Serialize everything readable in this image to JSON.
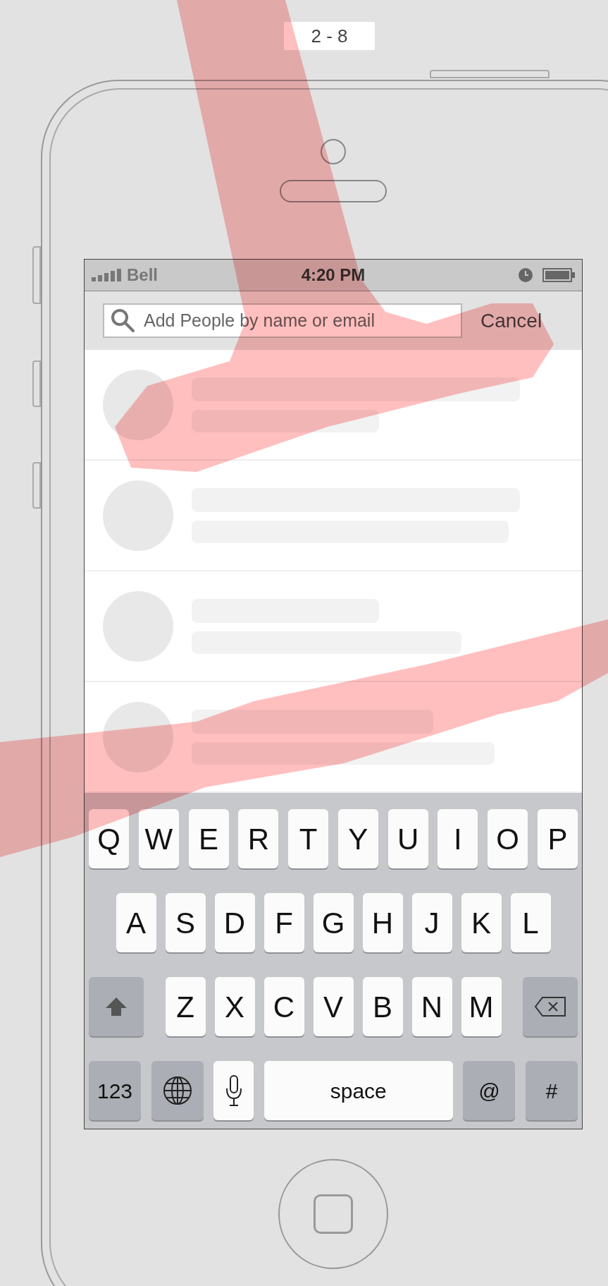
{
  "frame_label": "2 - 8",
  "status_bar": {
    "carrier": "Bell",
    "time": "4:20 PM"
  },
  "search": {
    "placeholder": "Add People by name or email",
    "cancel": "Cancel"
  },
  "keyboard": {
    "rows": [
      {
        "keys": [
          {
            "kind": "letter",
            "label": "Q"
          },
          {
            "kind": "letter",
            "label": "W"
          },
          {
            "kind": "letter",
            "label": "E"
          },
          {
            "kind": "letter",
            "label": "R"
          },
          {
            "kind": "letter",
            "label": "T"
          },
          {
            "kind": "letter",
            "label": "Y"
          },
          {
            "kind": "letter",
            "label": "U"
          },
          {
            "kind": "letter",
            "label": "I"
          },
          {
            "kind": "letter",
            "label": "O"
          },
          {
            "kind": "letter",
            "label": "P"
          }
        ]
      },
      {
        "keys": [
          {
            "kind": "letter",
            "label": "A"
          },
          {
            "kind": "letter",
            "label": "S"
          },
          {
            "kind": "letter",
            "label": "D"
          },
          {
            "kind": "letter",
            "label": "F"
          },
          {
            "kind": "letter",
            "label": "G"
          },
          {
            "kind": "letter",
            "label": "H"
          },
          {
            "kind": "letter",
            "label": "J"
          },
          {
            "kind": "letter",
            "label": "K"
          },
          {
            "kind": "letter",
            "label": "L"
          }
        ]
      },
      {
        "keys": [
          {
            "kind": "shift"
          },
          {
            "kind": "letter",
            "label": "Z"
          },
          {
            "kind": "letter",
            "label": "X"
          },
          {
            "kind": "letter",
            "label": "C"
          },
          {
            "kind": "letter",
            "label": "V"
          },
          {
            "kind": "letter",
            "label": "B"
          },
          {
            "kind": "letter",
            "label": "N"
          },
          {
            "kind": "letter",
            "label": "M"
          },
          {
            "kind": "delete"
          }
        ]
      },
      {
        "keys": [
          {
            "kind": "mode",
            "label": "123"
          },
          {
            "kind": "globe"
          },
          {
            "kind": "mic"
          },
          {
            "kind": "space",
            "label": "space"
          },
          {
            "kind": "mode",
            "label": "@"
          },
          {
            "kind": "mode",
            "label": "#"
          }
        ]
      }
    ]
  }
}
